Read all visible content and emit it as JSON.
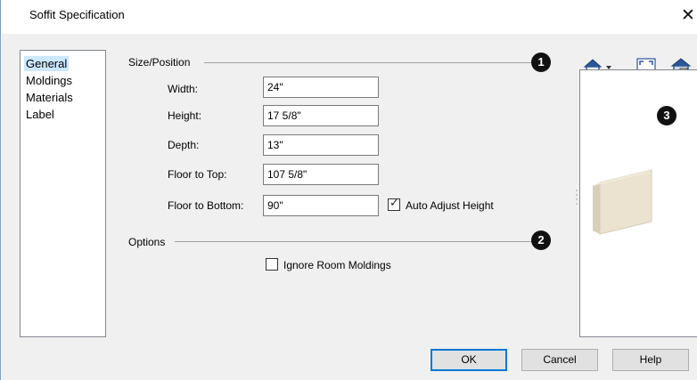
{
  "window": {
    "title": "Soffit Specification",
    "close_glyph": "✕"
  },
  "nav": {
    "items": [
      "General",
      "Moldings",
      "Materials",
      "Label"
    ],
    "selected": "General"
  },
  "size_position": {
    "group_label": "Size/Position",
    "callout": "1",
    "width": {
      "label": "Width:",
      "value": "24\""
    },
    "height": {
      "label": "Height:",
      "value": "17 5/8\""
    },
    "depth": {
      "label": "Depth:",
      "value": "13\""
    },
    "floor_to_top": {
      "label": "Floor to Top:",
      "value": "107 5/8\""
    },
    "floor_to_bottom": {
      "label": "Floor to Bottom:",
      "value": "90\""
    },
    "auto_adjust": {
      "label": "Auto Adjust Height",
      "checked": true
    }
  },
  "options": {
    "group_label": "Options",
    "callout": "2",
    "ignore_room_moldings": {
      "label": "Ignore Room Moldings",
      "checked": false
    }
  },
  "preview": {
    "callout": "3",
    "toolbar_icons": [
      "view-type-dropdown-icon",
      "fit-view-icon",
      "3d-view-toggle-icon"
    ],
    "object_color": "#ebe3cf"
  },
  "buttons": {
    "ok": "OK",
    "cancel": "Cancel",
    "help": "Help"
  },
  "colors": {
    "selection": "#cce8ff",
    "default_button_border": "#0078d7",
    "dialog_bg": "#f0f0f0"
  }
}
